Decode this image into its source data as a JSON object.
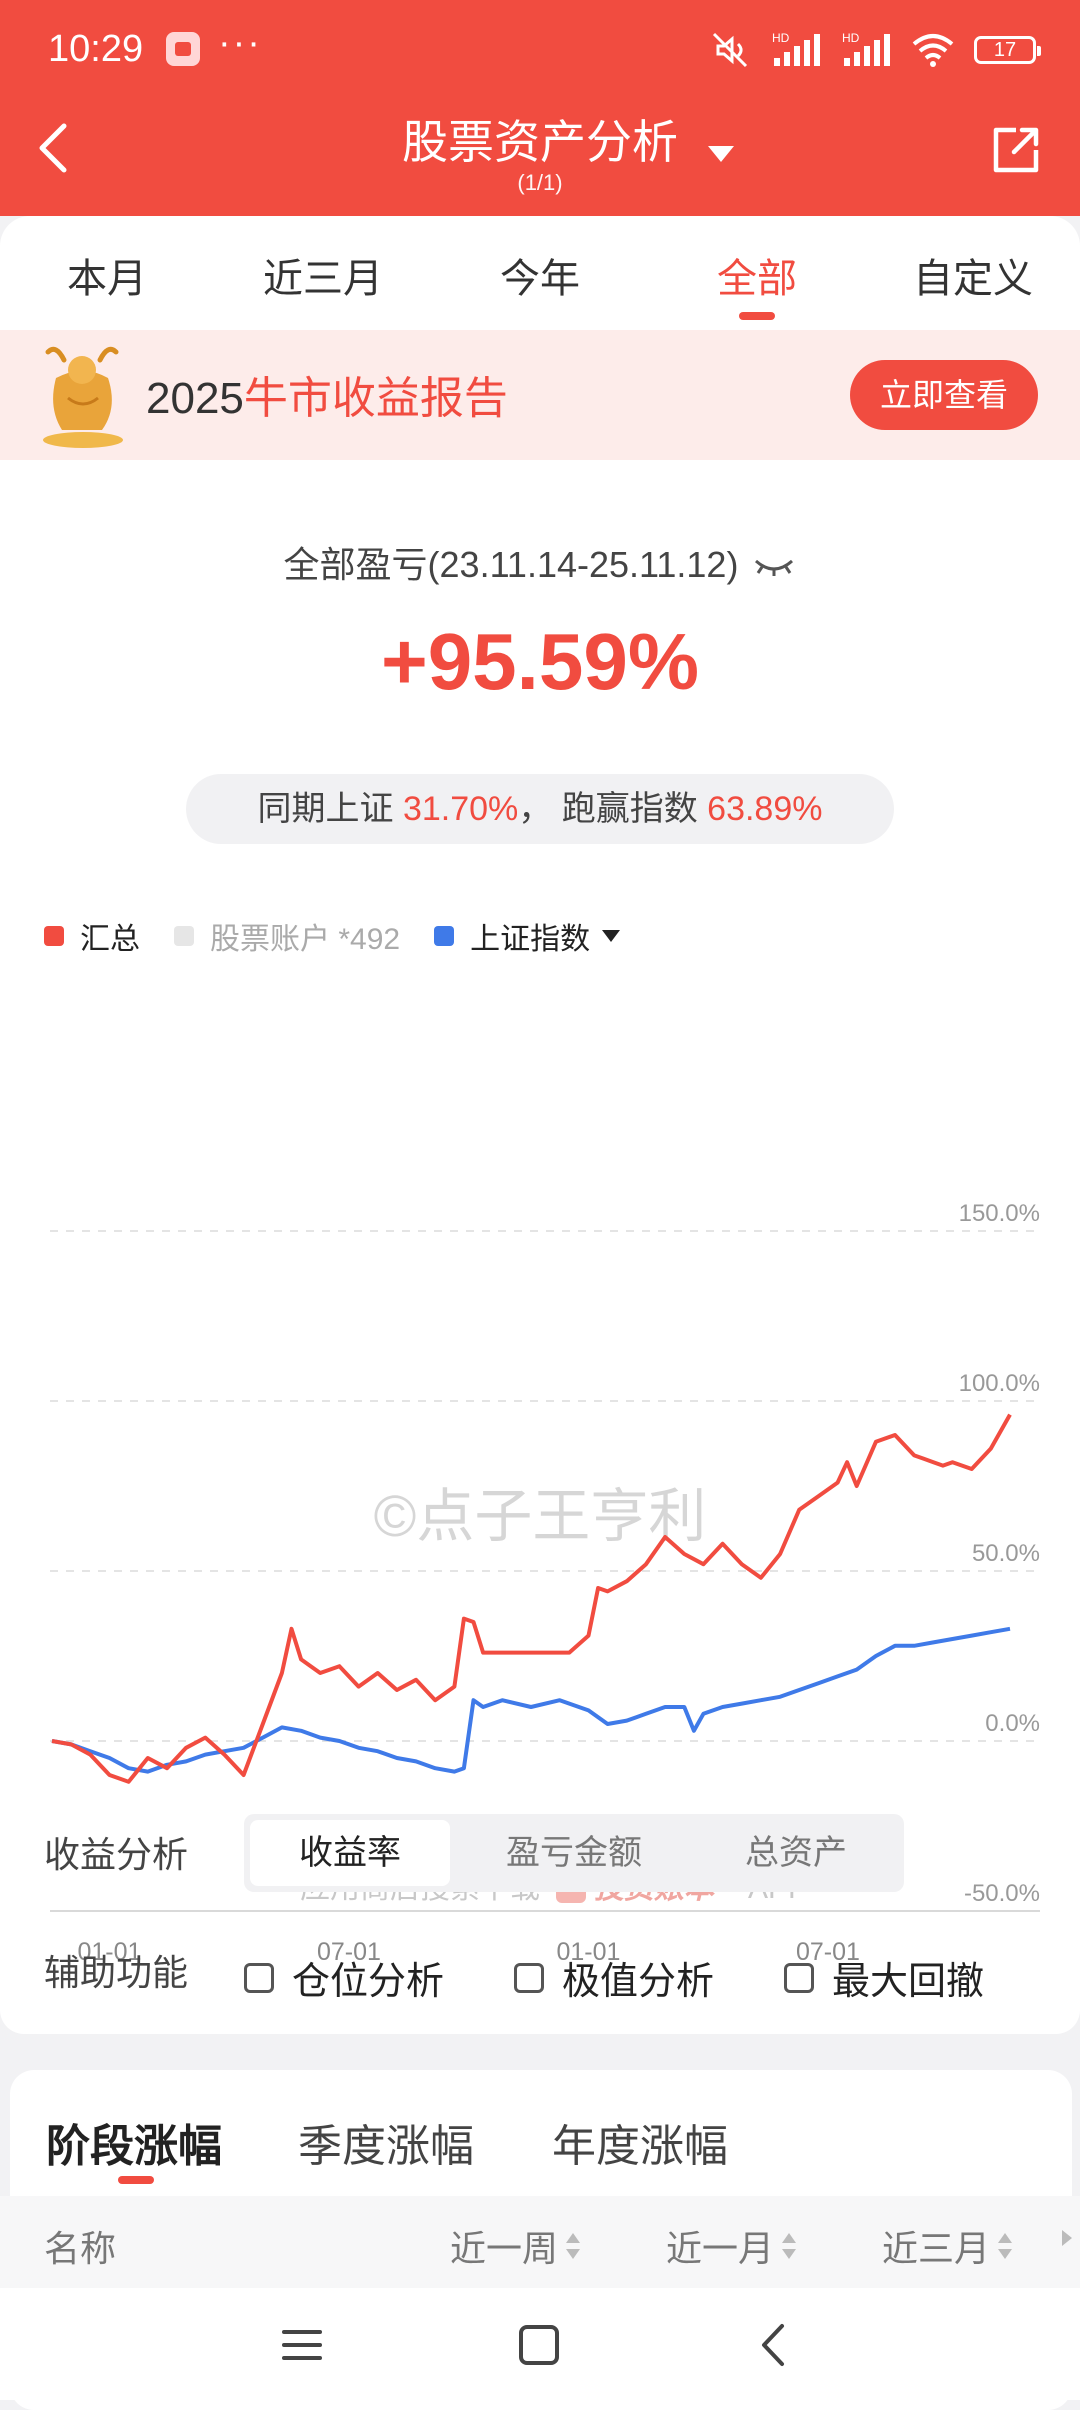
{
  "status_bar": {
    "time": "10:29",
    "dots": "···",
    "battery": "17",
    "signal1": "HD",
    "signal2": "HD"
  },
  "header": {
    "title": "股票资产分析",
    "subtitle": "(1/1)"
  },
  "tabs": [
    {
      "label": "本月"
    },
    {
      "label": "近三月"
    },
    {
      "label": "今年"
    },
    {
      "label": "全部",
      "active": true
    },
    {
      "label": "自定义"
    }
  ],
  "banner": {
    "prefix": "2025",
    "highlight": "牛市收益报告",
    "button": "立即查看"
  },
  "summary": {
    "label": "全部盈亏(23.11.14-25.11.12)",
    "value": "+95.59%",
    "compare_text1": "同期上证",
    "compare_value1": "31.70%",
    "compare_sep": "，",
    "compare_text2": "跑赢指数",
    "compare_value2": "63.89%"
  },
  "legend": [
    {
      "label": "汇总",
      "color": "#f14c40"
    },
    {
      "label": "股票账户 *492",
      "color": "#e0e0e0"
    },
    {
      "label": "上证指数",
      "color": "#3f7ae8"
    }
  ],
  "chart_data": {
    "type": "line",
    "ylim": [
      -50,
      150
    ],
    "y_ticks": [
      "150.0%",
      "100.0%",
      "50.0%",
      "0.0%",
      "-50.0%"
    ],
    "x_tick_labels": [
      "01-01",
      "07-01",
      "01-01",
      "07-01"
    ],
    "x_tick_positions": [
      0.06,
      0.31,
      0.56,
      0.81
    ],
    "watermark": "©点子王亨利",
    "footer_watermark": "应用商店搜索下载",
    "footer_brand": "投资账本",
    "footer_app": "APP",
    "series": [
      {
        "name": "汇总",
        "color": "#f14c40",
        "x": [
          0.0,
          0.02,
          0.04,
          0.06,
          0.08,
          0.1,
          0.12,
          0.14,
          0.16,
          0.18,
          0.2,
          0.22,
          0.24,
          0.25,
          0.26,
          0.27,
          0.28,
          0.3,
          0.32,
          0.34,
          0.36,
          0.38,
          0.4,
          0.42,
          0.43,
          0.44,
          0.45,
          0.47,
          0.5,
          0.54,
          0.56,
          0.57,
          0.58,
          0.6,
          0.62,
          0.64,
          0.66,
          0.68,
          0.7,
          0.72,
          0.74,
          0.76,
          0.78,
          0.8,
          0.82,
          0.83,
          0.84,
          0.86,
          0.88,
          0.9,
          0.91,
          0.92,
          0.93,
          0.94,
          0.96,
          0.98,
          1.0
        ],
        "y": [
          0,
          -1,
          -4,
          -10,
          -12,
          -5,
          -8,
          -2,
          1,
          -4,
          -10,
          5,
          20,
          33,
          24,
          22,
          20,
          22,
          16,
          20,
          15,
          18,
          12,
          16,
          36,
          35,
          26,
          26,
          26,
          26,
          31,
          45,
          44,
          47,
          52,
          60,
          55,
          52,
          58,
          52,
          48,
          55,
          68,
          72,
          76,
          82,
          75,
          88,
          90,
          84,
          83,
          82,
          81,
          82,
          80,
          86,
          96
        ]
      },
      {
        "name": "上证指数",
        "color": "#3f7ae8",
        "x": [
          0.0,
          0.02,
          0.04,
          0.06,
          0.08,
          0.1,
          0.12,
          0.14,
          0.16,
          0.18,
          0.2,
          0.22,
          0.24,
          0.26,
          0.28,
          0.3,
          0.32,
          0.34,
          0.36,
          0.38,
          0.4,
          0.42,
          0.43,
          0.44,
          0.45,
          0.47,
          0.5,
          0.53,
          0.56,
          0.58,
          0.6,
          0.62,
          0.64,
          0.66,
          0.67,
          0.68,
          0.7,
          0.72,
          0.74,
          0.76,
          0.78,
          0.8,
          0.82,
          0.84,
          0.86,
          0.88,
          0.9,
          0.92,
          0.94,
          0.96,
          0.98,
          1.0
        ],
        "y": [
          0,
          -1,
          -3,
          -5,
          -8,
          -9,
          -7,
          -6,
          -4,
          -3,
          -2,
          1,
          4,
          3,
          1,
          0,
          -2,
          -3,
          -5,
          -6,
          -8,
          -9,
          -8,
          12,
          10,
          12,
          10,
          12,
          9,
          5,
          6,
          8,
          10,
          10,
          3,
          8,
          10,
          11,
          12,
          13,
          15,
          17,
          19,
          21,
          25,
          28,
          28,
          29,
          30,
          31,
          32,
          33
        ]
      }
    ]
  },
  "analysis": {
    "label": "收益分析",
    "options": [
      {
        "label": "收益率",
        "active": true
      },
      {
        "label": "盈亏金额"
      },
      {
        "label": "总资产"
      }
    ]
  },
  "aux": {
    "label": "辅助功能",
    "options": [
      {
        "label": "仓位分析"
      },
      {
        "label": "极值分析"
      },
      {
        "label": "最大回撤"
      }
    ]
  },
  "perf_tabs": [
    {
      "label": "阶段涨幅",
      "active": true
    },
    {
      "label": "季度涨幅"
    },
    {
      "label": "年度涨幅"
    }
  ],
  "table_header": {
    "name": "名称",
    "c1": "近一周",
    "c2": "近一月",
    "c3": "近三月"
  }
}
